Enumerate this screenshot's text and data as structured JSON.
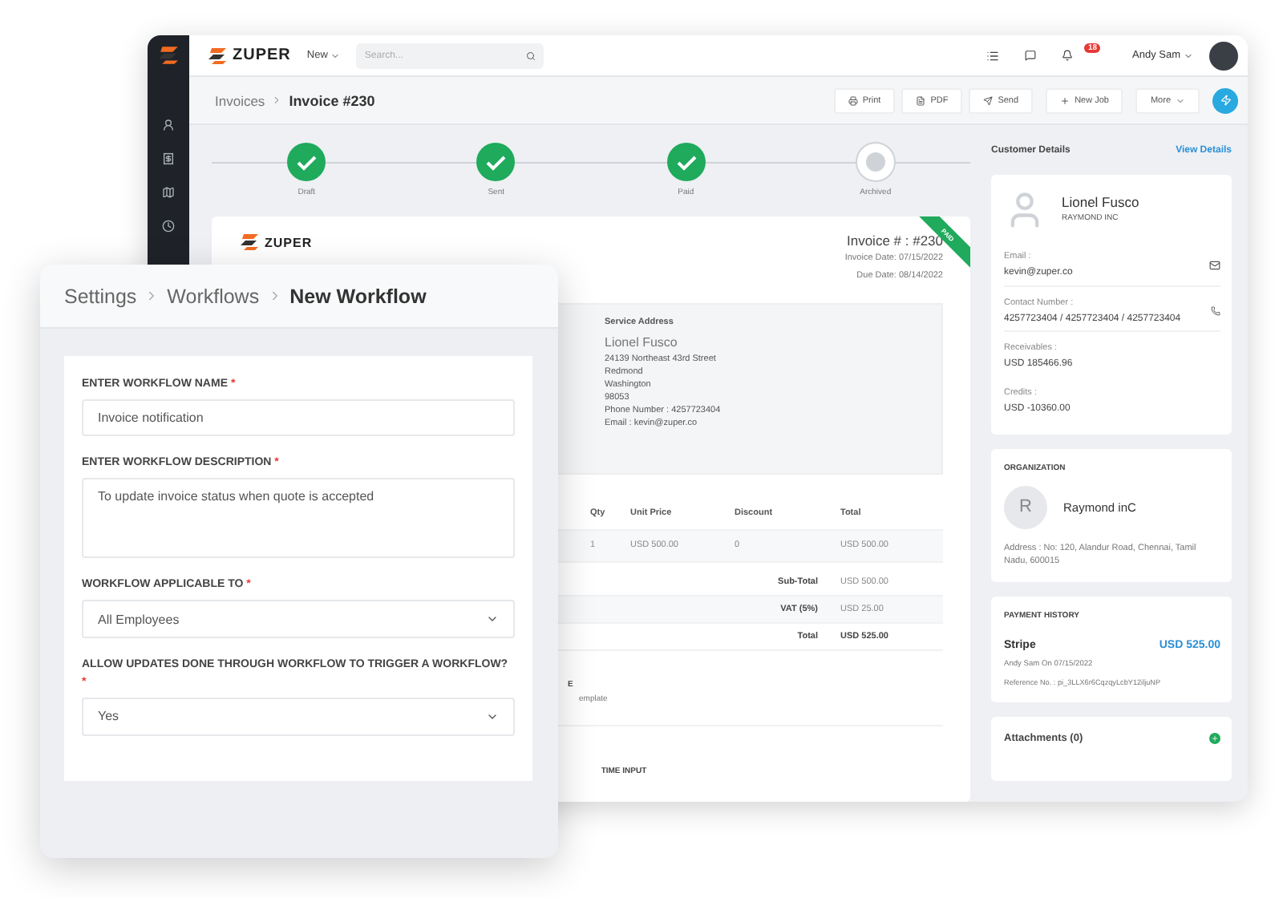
{
  "app": {
    "brand": "ZUPER",
    "new_menu": "New",
    "search": {
      "placeholder": "Search..."
    },
    "notifications_badge": "18",
    "user": "Andy Sam"
  },
  "breadcrumb": [
    "Invoices",
    "Invoice #230"
  ],
  "actions": [
    {
      "label": "Print",
      "kind": "print"
    },
    {
      "label": "PDF",
      "kind": "pdf"
    },
    {
      "label": "Send",
      "kind": "send"
    },
    {
      "label": "New Job",
      "kind": "add"
    },
    {
      "label": "More",
      "kind": "menu"
    }
  ],
  "steps": [
    {
      "label": "Draft",
      "completed": true
    },
    {
      "label": "Sent",
      "completed": true
    },
    {
      "label": "Paid",
      "completed": true
    },
    {
      "label": "Archived",
      "completed": false
    }
  ],
  "invoice": {
    "brand": "ZUPER",
    "ribbon": "PAID",
    "number": "Invoice # : #230",
    "date": "Invoice Date: 07/15/2022",
    "due": "Due Date: 08/14/2022",
    "service_address": {
      "title": "Service Address",
      "name": "Lionel Fusco",
      "lines": [
        "24139 Northeast 43rd Street",
        "Redmond",
        "Washington",
        "98053",
        "Phone Number : 4257723404",
        "Email : kevin@zuper.co"
      ]
    },
    "table": {
      "columns": [
        "Qty",
        "Unit Price",
        "Discount",
        "Total"
      ],
      "rows": [
        [
          "1",
          "USD 500.00",
          "0",
          "USD 500.00"
        ]
      ]
    },
    "totals": [
      {
        "label": "Sub-Total",
        "value": "USD 500.00"
      },
      {
        "label": "VAT (5%)",
        "value": "USD 25.00"
      },
      {
        "label": "Total",
        "value": "USD 525.00"
      }
    ],
    "note": {
      "title": "E",
      "text": "emplate"
    },
    "section_title": "TIME INPUT"
  },
  "customer": {
    "title": "Customer Details",
    "link": "View Details",
    "name": "Lionel Fusco",
    "company": "RAYMOND INC",
    "details": [
      {
        "label": "Email :",
        "value": "kevin@zuper.co",
        "kind": "email"
      },
      {
        "label": "Contact Number :",
        "value": "4257723404 / 4257723404 / 4257723404",
        "kind": "phone"
      },
      {
        "label": "Receivables :",
        "value": "USD 185466.96",
        "kind": "plain"
      },
      {
        "label": "Credits :",
        "value": "USD -10360.00",
        "kind": "plain"
      }
    ]
  },
  "organization": {
    "title": "ORGANIZATION",
    "initial": "R",
    "name": "Raymond inC",
    "address": "Address : No: 120, Alandur Road, Chennai, Tamil Nadu, 600015"
  },
  "payment_history": {
    "title": "PAYMENT HISTORY",
    "method": "Stripe",
    "amount": "USD 525.00",
    "by": "Andy Sam On 07/15/2022",
    "reference": "Reference No. : pi_3LLX6r6CqzqyLcbY12iljuNP"
  },
  "attachments": {
    "title": "Attachments (0)"
  },
  "workflow": {
    "breadcrumb": [
      "Settings",
      "Workflows",
      "New Workflow"
    ],
    "fields": [
      {
        "label": "ENTER WORKFLOW NAME",
        "mark": "*",
        "kind": "text",
        "value": "Invoice notification"
      },
      {
        "label": "ENTER WORKFLOW DESCRIPTION",
        "mark": "*",
        "kind": "textarea",
        "value": "To update invoice status when quote is accepted"
      },
      {
        "label": "WORKFLOW APPLICABLE TO",
        "mark": "*",
        "kind": "select",
        "value": "All Employees"
      },
      {
        "label": "ALLOW UPDATES DONE THROUGH WORKFLOW TO TRIGGER A WORKFLOW?",
        "mark": "*",
        "kind": "select",
        "value": "Yes"
      }
    ]
  }
}
